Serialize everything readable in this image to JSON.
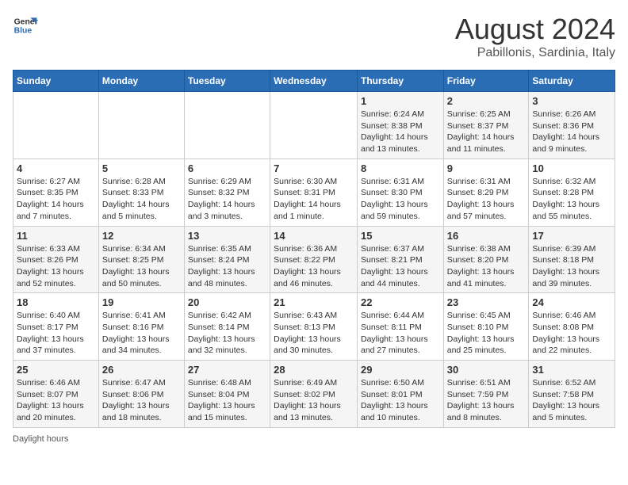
{
  "logo": {
    "line1": "General",
    "line2": "Blue"
  },
  "title": "August 2024",
  "subtitle": "Pabillonis, Sardinia, Italy",
  "days_header": [
    "Sunday",
    "Monday",
    "Tuesday",
    "Wednesday",
    "Thursday",
    "Friday",
    "Saturday"
  ],
  "weeks": [
    [
      {
        "day": "",
        "info": ""
      },
      {
        "day": "",
        "info": ""
      },
      {
        "day": "",
        "info": ""
      },
      {
        "day": "",
        "info": ""
      },
      {
        "day": "1",
        "info": "Sunrise: 6:24 AM\nSunset: 8:38 PM\nDaylight: 14 hours and 13 minutes."
      },
      {
        "day": "2",
        "info": "Sunrise: 6:25 AM\nSunset: 8:37 PM\nDaylight: 14 hours and 11 minutes."
      },
      {
        "day": "3",
        "info": "Sunrise: 6:26 AM\nSunset: 8:36 PM\nDaylight: 14 hours and 9 minutes."
      }
    ],
    [
      {
        "day": "4",
        "info": "Sunrise: 6:27 AM\nSunset: 8:35 PM\nDaylight: 14 hours and 7 minutes."
      },
      {
        "day": "5",
        "info": "Sunrise: 6:28 AM\nSunset: 8:33 PM\nDaylight: 14 hours and 5 minutes."
      },
      {
        "day": "6",
        "info": "Sunrise: 6:29 AM\nSunset: 8:32 PM\nDaylight: 14 hours and 3 minutes."
      },
      {
        "day": "7",
        "info": "Sunrise: 6:30 AM\nSunset: 8:31 PM\nDaylight: 14 hours and 1 minute."
      },
      {
        "day": "8",
        "info": "Sunrise: 6:31 AM\nSunset: 8:30 PM\nDaylight: 13 hours and 59 minutes."
      },
      {
        "day": "9",
        "info": "Sunrise: 6:31 AM\nSunset: 8:29 PM\nDaylight: 13 hours and 57 minutes."
      },
      {
        "day": "10",
        "info": "Sunrise: 6:32 AM\nSunset: 8:28 PM\nDaylight: 13 hours and 55 minutes."
      }
    ],
    [
      {
        "day": "11",
        "info": "Sunrise: 6:33 AM\nSunset: 8:26 PM\nDaylight: 13 hours and 52 minutes."
      },
      {
        "day": "12",
        "info": "Sunrise: 6:34 AM\nSunset: 8:25 PM\nDaylight: 13 hours and 50 minutes."
      },
      {
        "day": "13",
        "info": "Sunrise: 6:35 AM\nSunset: 8:24 PM\nDaylight: 13 hours and 48 minutes."
      },
      {
        "day": "14",
        "info": "Sunrise: 6:36 AM\nSunset: 8:22 PM\nDaylight: 13 hours and 46 minutes."
      },
      {
        "day": "15",
        "info": "Sunrise: 6:37 AM\nSunset: 8:21 PM\nDaylight: 13 hours and 44 minutes."
      },
      {
        "day": "16",
        "info": "Sunrise: 6:38 AM\nSunset: 8:20 PM\nDaylight: 13 hours and 41 minutes."
      },
      {
        "day": "17",
        "info": "Sunrise: 6:39 AM\nSunset: 8:18 PM\nDaylight: 13 hours and 39 minutes."
      }
    ],
    [
      {
        "day": "18",
        "info": "Sunrise: 6:40 AM\nSunset: 8:17 PM\nDaylight: 13 hours and 37 minutes."
      },
      {
        "day": "19",
        "info": "Sunrise: 6:41 AM\nSunset: 8:16 PM\nDaylight: 13 hours and 34 minutes."
      },
      {
        "day": "20",
        "info": "Sunrise: 6:42 AM\nSunset: 8:14 PM\nDaylight: 13 hours and 32 minutes."
      },
      {
        "day": "21",
        "info": "Sunrise: 6:43 AM\nSunset: 8:13 PM\nDaylight: 13 hours and 30 minutes."
      },
      {
        "day": "22",
        "info": "Sunrise: 6:44 AM\nSunset: 8:11 PM\nDaylight: 13 hours and 27 minutes."
      },
      {
        "day": "23",
        "info": "Sunrise: 6:45 AM\nSunset: 8:10 PM\nDaylight: 13 hours and 25 minutes."
      },
      {
        "day": "24",
        "info": "Sunrise: 6:46 AM\nSunset: 8:08 PM\nDaylight: 13 hours and 22 minutes."
      }
    ],
    [
      {
        "day": "25",
        "info": "Sunrise: 6:46 AM\nSunset: 8:07 PM\nDaylight: 13 hours and 20 minutes."
      },
      {
        "day": "26",
        "info": "Sunrise: 6:47 AM\nSunset: 8:06 PM\nDaylight: 13 hours and 18 minutes."
      },
      {
        "day": "27",
        "info": "Sunrise: 6:48 AM\nSunset: 8:04 PM\nDaylight: 13 hours and 15 minutes."
      },
      {
        "day": "28",
        "info": "Sunrise: 6:49 AM\nSunset: 8:02 PM\nDaylight: 13 hours and 13 minutes."
      },
      {
        "day": "29",
        "info": "Sunrise: 6:50 AM\nSunset: 8:01 PM\nDaylight: 13 hours and 10 minutes."
      },
      {
        "day": "30",
        "info": "Sunrise: 6:51 AM\nSunset: 7:59 PM\nDaylight: 13 hours and 8 minutes."
      },
      {
        "day": "31",
        "info": "Sunrise: 6:52 AM\nSunset: 7:58 PM\nDaylight: 13 hours and 5 minutes."
      }
    ]
  ],
  "footer": "Daylight hours"
}
